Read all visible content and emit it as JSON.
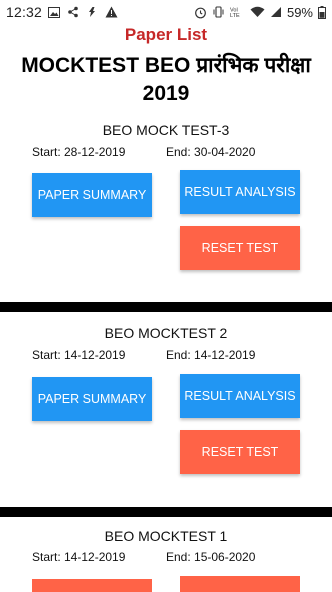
{
  "status_bar": {
    "time": "12:32",
    "battery_percent": "59%",
    "icons_left": [
      "image-icon",
      "share-icon",
      "cloud-icon",
      "warning-icon"
    ],
    "icons_right": [
      "alarm-icon",
      "vibrate-icon",
      "volte-icon",
      "wifi-icon",
      "signal-icon",
      "battery-icon"
    ]
  },
  "header": {
    "paper_list": "Paper List",
    "exam_title": "MOCKTEST BEO प्रारंभिक परीक्षा 2019"
  },
  "tests": [
    {
      "name": "BEO MOCK TEST-3",
      "start": "Start: 28-12-2019",
      "end": "End: 30-04-2020",
      "paper_summary": "PAPER SUMMARY",
      "result_analysis": "RESULT ANALYSIS",
      "reset_test": "RESET TEST"
    },
    {
      "name": "BEO MOCKTEST 2",
      "start": "Start: 14-12-2019",
      "end": "End: 14-12-2019",
      "paper_summary": "PAPER SUMMARY",
      "result_analysis": "RESULT ANALYSIS",
      "reset_test": "RESET TEST"
    },
    {
      "name": "BEO MOCKTEST 1",
      "start": "Start: 14-12-2019",
      "end": "End: 15-06-2020",
      "paper_summary": "",
      "result_analysis": "",
      "reset_test": ""
    }
  ],
  "colors": {
    "title_red": "#c62828",
    "button_blue": "#2196f3",
    "button_red": "#ff6347",
    "divider": "#000000"
  }
}
